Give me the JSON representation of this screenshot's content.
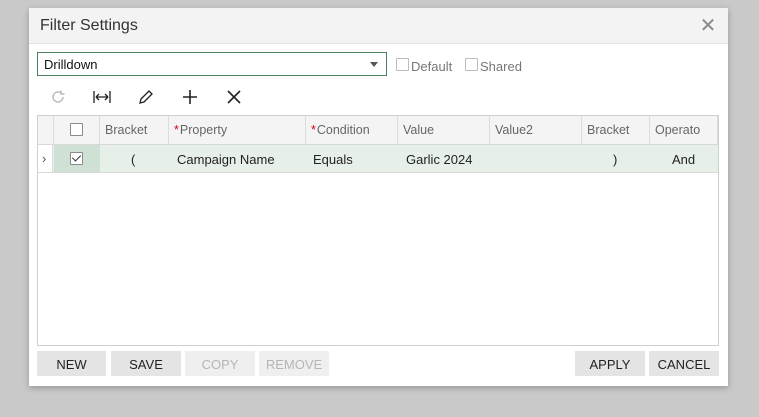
{
  "dialog": {
    "title": "Filter Settings"
  },
  "filter": {
    "selected": "Drilldown",
    "default_label": "Default",
    "shared_label": "Shared"
  },
  "toolbar": {
    "icons": [
      "refresh-icon",
      "fit-columns-icon",
      "edit-icon",
      "add-icon",
      "delete-icon"
    ]
  },
  "grid": {
    "columns": [
      {
        "label": "Bracket",
        "required": false
      },
      {
        "label": "Property",
        "required": true
      },
      {
        "label": "Condition",
        "required": true
      },
      {
        "label": "Value",
        "required": false
      },
      {
        "label": "Value2",
        "required": false
      },
      {
        "label": "Bracket",
        "required": false
      },
      {
        "label": "Operato",
        "required": false
      }
    ],
    "rows": [
      {
        "selected": true,
        "open_bracket": "(",
        "property": "Campaign Name",
        "condition": "Equals",
        "value": "Garlic 2024",
        "value2": "",
        "close_bracket": ")",
        "operator": "And"
      }
    ]
  },
  "footer": {
    "new": "NEW",
    "save": "SAVE",
    "copy": "COPY",
    "remove": "REMOVE",
    "apply": "APPLY",
    "cancel": "CANCEL"
  },
  "colors": {
    "accent_border": "#4a7f5c",
    "row_highlight": "#e7efe9",
    "required": "#d0021b"
  }
}
